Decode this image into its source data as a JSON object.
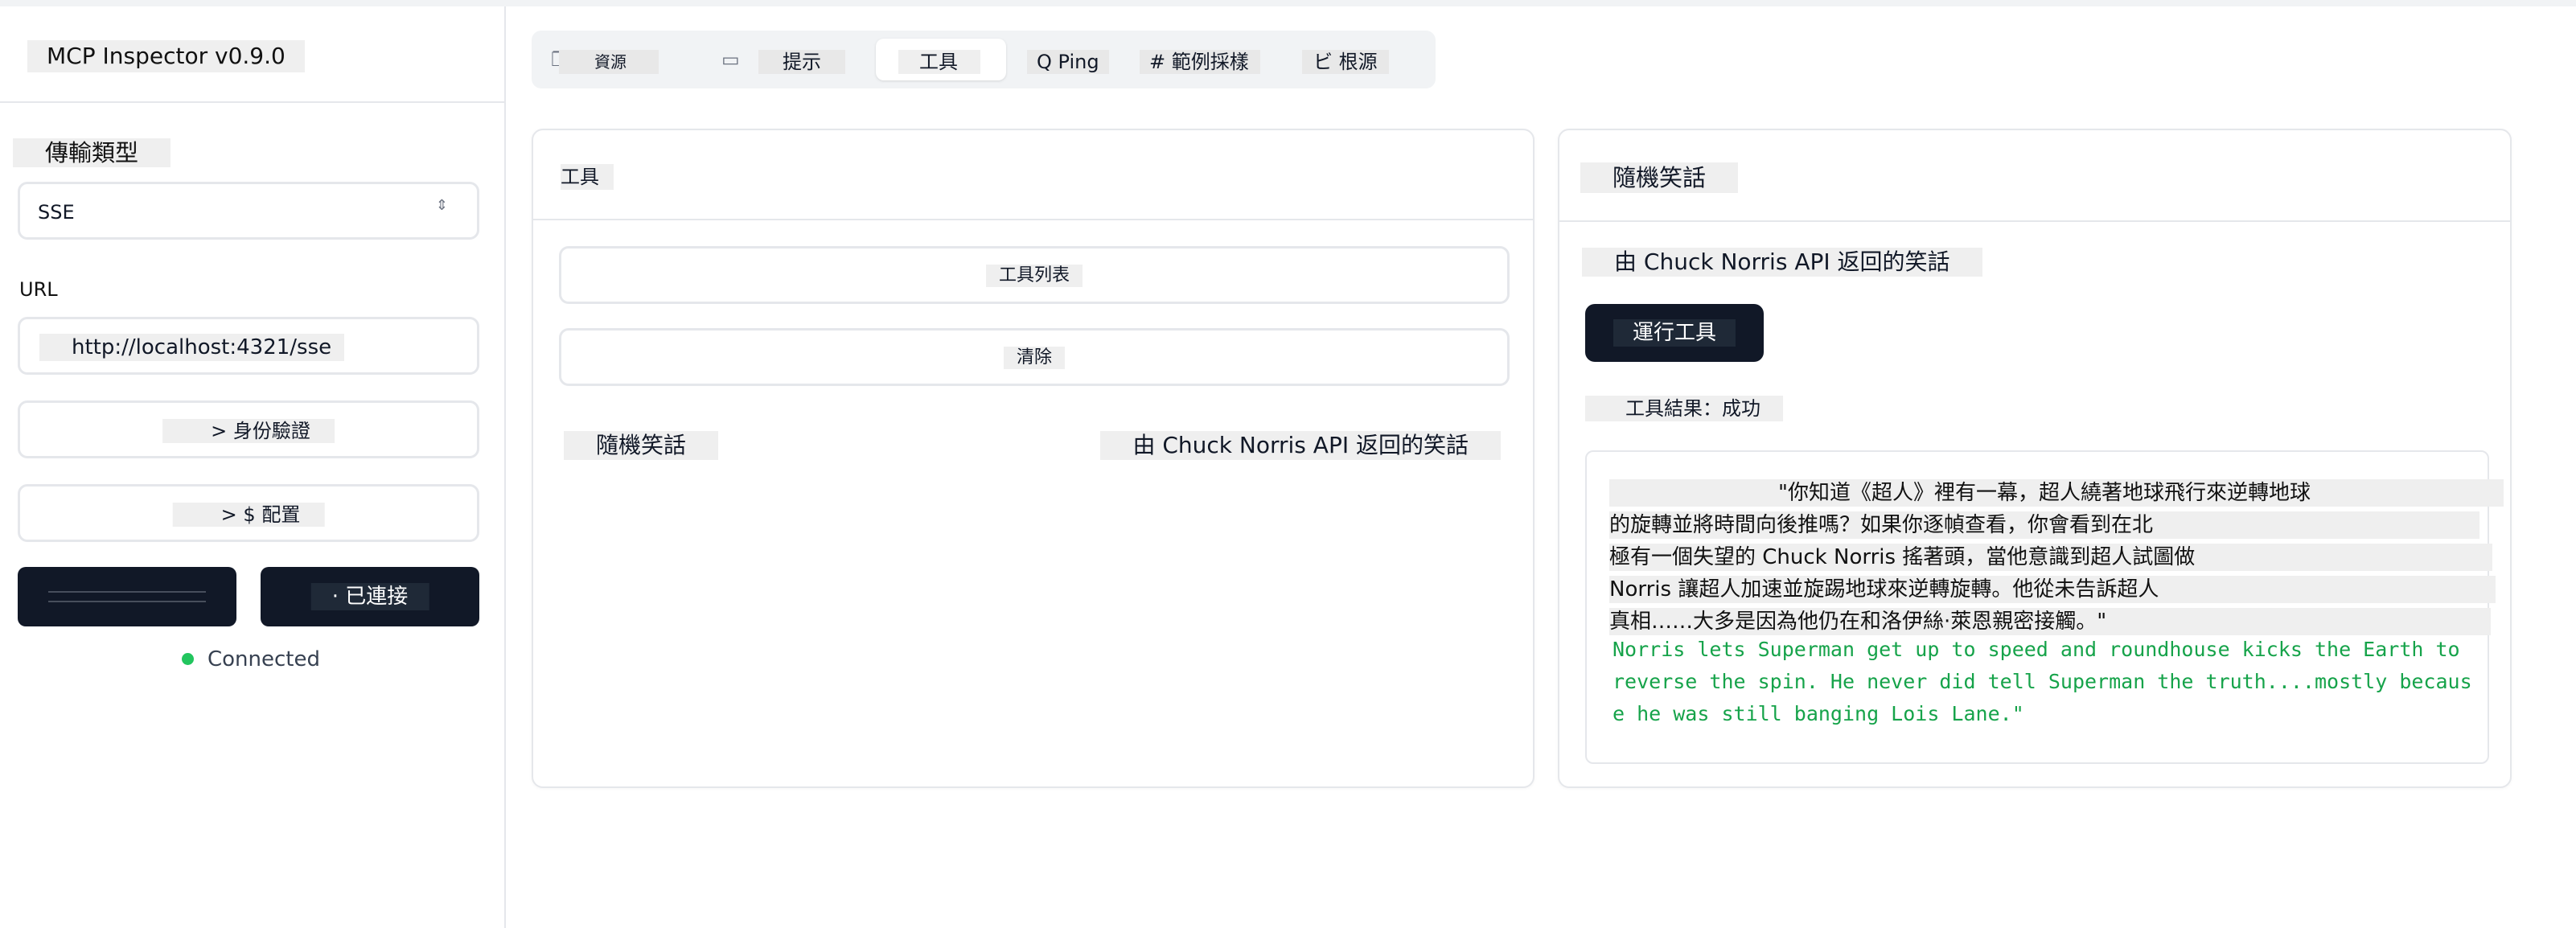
{
  "app": {
    "title": "MCP Inspector v0.9.0"
  },
  "sidebar": {
    "transport_label": "傳輸類型",
    "transport_value": "SSE",
    "url_label": "URL",
    "url_value": "http://localhost:4321/sse",
    "auth_button": "> 身份驗證",
    "config_button": "> $ 配置",
    "connect_button": "· 已連接",
    "status": "Connected"
  },
  "tabs": [
    {
      "label": "資源",
      "icon": "files-icon"
    },
    {
      "label": "提示",
      "icon": "message-icon"
    },
    {
      "label": "工具",
      "icon": "wrench-icon",
      "active": true
    },
    {
      "label": "Q Ping"
    },
    {
      "label": "# 範例採樣"
    },
    {
      "label": "ビ 根源"
    }
  ],
  "tools_panel": {
    "heading": "工具",
    "list_button": "工具列表",
    "clear_button": "清除",
    "tool_name": "隨機笑話",
    "tool_description": "由 Chuck Norris API 返回的笑話"
  },
  "detail_panel": {
    "title": "隨機笑話",
    "description": "由 Chuck Norris API 返回的笑話",
    "run_button": "運行工具",
    "result_label": "工具結果：成功",
    "result_zh": [
      "\"你知道《超人》裡有一幕，超人繞著地球飛行來逆轉地球",
      "的旋轉並將時間向後推嗎？如果你逐幀查看，你會看到在北",
      "極有一個失望的 Chuck Norris 搖著頭，當他意識到超人試圖做",
      "Norris 讓超人加速並旋踢地球來逆轉旋轉。他從未告訴超人",
      "真相……大多是因為他仍在和洛伊絲·萊恩親密接觸。\""
    ],
    "result_en": [
      "Norris lets Superman get up to speed and roundhouse kicks the Earth to",
      "reverse the spin. He never did tell Superman the truth....mostly becaus",
      "e he was still banging Lois Lane.\""
    ]
  },
  "colors": {
    "dark": "#111827",
    "success": "#16a34a",
    "status_dot": "#22c55e"
  }
}
